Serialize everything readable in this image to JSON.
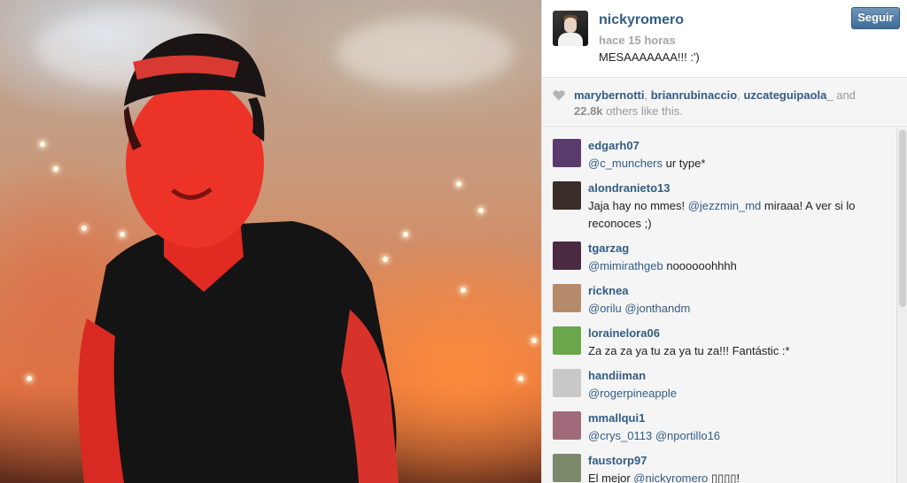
{
  "post": {
    "username": "nickyromero",
    "time": "hace 15 horas",
    "caption": "MESAAAAAAA!!! :')",
    "follow_label": "Seguir"
  },
  "likes": {
    "likers": [
      "marybernotti",
      "brianrubinaccio",
      "uzcateguipaola_"
    ],
    "sep1": ", ",
    "sep2": ", ",
    "and_text": " and",
    "count": "22.8k",
    "others_text": " others like this."
  },
  "comments": [
    {
      "user": "edgarh07",
      "parts": [
        {
          "t": "@c_munchers",
          "m": true
        },
        {
          "t": " ur type*",
          "m": false
        }
      ],
      "avatar_color": "#5b3a6e"
    },
    {
      "user": "alondranieto13",
      "parts": [
        {
          "t": "Jaja hay no mmes! ",
          "m": false
        },
        {
          "t": "@jezzmin_md",
          "m": true
        },
        {
          "t": " miraaa! A ver si lo reconoces ;)",
          "m": false
        }
      ],
      "avatar_color": "#3a2d2a"
    },
    {
      "user": "tgarzag",
      "parts": [
        {
          "t": "@mimirathgeb",
          "m": true
        },
        {
          "t": " noooooohhhh",
          "m": false
        }
      ],
      "avatar_color": "#4a2a40"
    },
    {
      "user": "ricknea",
      "parts": [
        {
          "t": "@orilu",
          "m": true
        },
        {
          "t": " ",
          "m": false
        },
        {
          "t": "@jonthandm",
          "m": true
        }
      ],
      "avatar_color": "#b58a6a"
    },
    {
      "user": "lorainelora06",
      "parts": [
        {
          "t": "Za za za ya tu za ya tu za!!! Fantástic :*",
          "m": false
        }
      ],
      "avatar_color": "#6aa64a"
    },
    {
      "user": "handiiman",
      "parts": [
        {
          "t": "@rogerpineapple",
          "m": true
        }
      ],
      "avatar_color": "#c8c8c8"
    },
    {
      "user": "mmallqui1",
      "parts": [
        {
          "t": "@crys_0113",
          "m": true
        },
        {
          "t": " ",
          "m": false
        },
        {
          "t": "@nportillo16",
          "m": true
        }
      ],
      "avatar_color": "#a06a7a"
    },
    {
      "user": "faustorp97",
      "parts": [
        {
          "t": "El mejor ",
          "m": false
        },
        {
          "t": "@nickyromero",
          "m": true
        },
        {
          "t": " ▯▯▯▯!",
          "m": false
        }
      ],
      "avatar_color": "#7a8a6a"
    }
  ]
}
